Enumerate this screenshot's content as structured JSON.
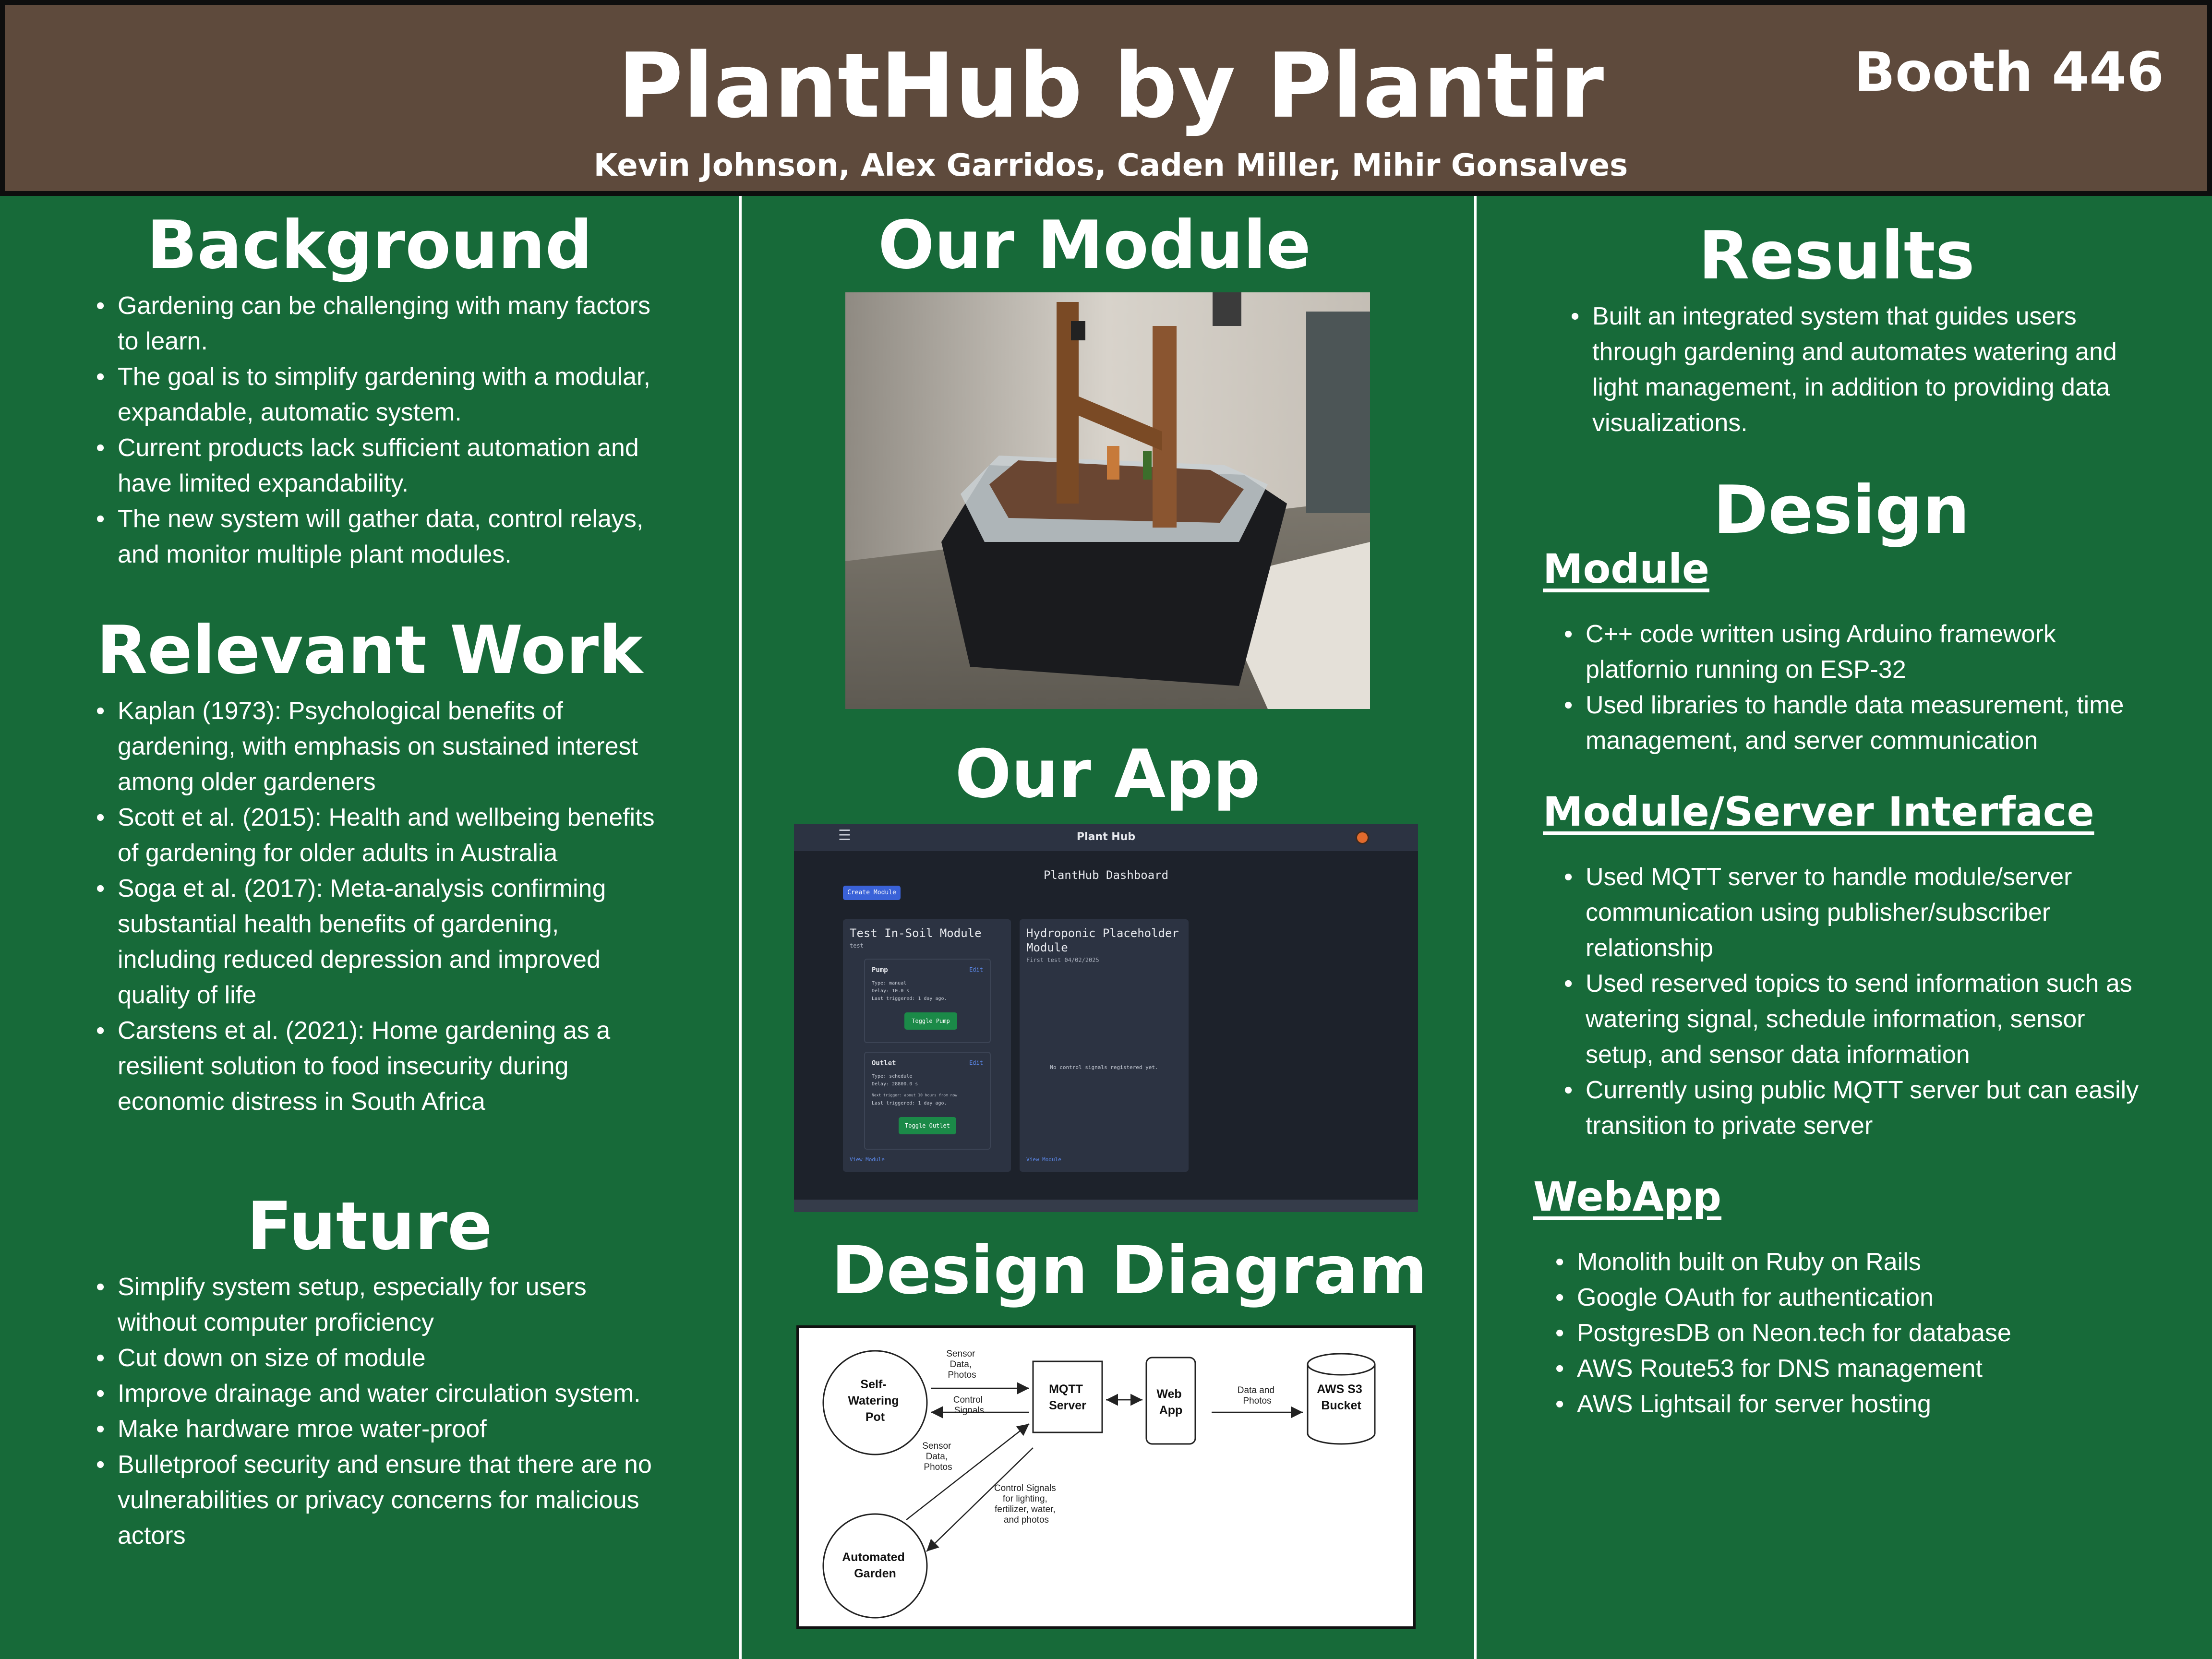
{
  "header": {
    "title": "PlantHub by Plantir",
    "authors": "Kevin Johnson, Alex Garridos, Caden Miller, Mihir Gonsalves",
    "booth": "Booth 446"
  },
  "background": {
    "heading": "Background",
    "bullets": [
      "Gardening can be challenging with many factors to learn.",
      "The goal is to simplify gardening with a modular, expandable, automatic system.",
      "Current products lack sufficient automation and have limited expandability.",
      "The new system will gather data, control relays, and monitor multiple plant modules."
    ]
  },
  "relevant_work": {
    "heading": "Relevant Work",
    "bullets": [
      "Kaplan (1973): Psychological benefits of gardening, with emphasis on sustained interest among older gardeners",
      "Scott et al. (2015): Health and wellbeing benefits of gardening for older adults in Australia",
      "Soga et al. (2017): Meta-analysis confirming substantial health benefits of gardening, including reduced depression and improved quality of life",
      "Carstens et al. (2021): Home gardening as a resilient solution to food insecurity during economic distress in South Africa"
    ]
  },
  "future": {
    "heading": "Future",
    "bullets": [
      "Simplify system setup, especially for users without computer proficiency",
      "Cut down on size of module",
      "Improve drainage and water circulation system.",
      "Make hardware mroe water-proof",
      "Bulletproof security and ensure that there are no vulnerabilities or privacy concerns for malicious actors"
    ]
  },
  "our_module": {
    "heading": "Our Module"
  },
  "our_app": {
    "heading": "Our App",
    "screenshot": {
      "brand": "Plant Hub",
      "dashboard_title": "PlantHub Dashboard",
      "create_button": "Create Module",
      "card1": {
        "title": "Test In-Soil Module",
        "subtitle": "test",
        "pump": {
          "title": "Pump",
          "edit": "Edit",
          "lines": [
            "Type: manual",
            "Delay: 10.0 s",
            "Last triggered: 1 day ago."
          ],
          "toggle": "Toggle Pump"
        },
        "outlet": {
          "title": "Outlet",
          "edit": "Edit",
          "lines": [
            "Type: schedule",
            "Delay: 28800.0 s",
            "Next trigger: about 10 hours from now",
            "Last triggered: 1 day ago."
          ],
          "toggle": "Toggle Outlet"
        },
        "view": "View Module"
      },
      "card2": {
        "title_line1": "Hydroponic Placeholder",
        "title_line2": "Module",
        "subtitle": "First test 04/02/2025",
        "no_signals": "No control signals registered yet.",
        "view": "View Module"
      }
    }
  },
  "design_diagram": {
    "heading": "Design Diagram",
    "nodes": {
      "self_watering_pot": [
        "Self-",
        "Watering",
        "Pot"
      ],
      "automated_garden": [
        "Automated",
        "Garden"
      ],
      "mqtt_server": [
        "MQTT",
        "Server"
      ],
      "web_app": [
        "Web",
        "App"
      ],
      "aws_s3": [
        "AWS S3",
        "Bucket"
      ]
    },
    "labels": {
      "sensor_top": [
        "Sensor",
        "Data,",
        "Photos"
      ],
      "control_top": [
        "Control",
        "Signals"
      ],
      "sensor_mid": [
        "Sensor",
        "Data,",
        "Photos"
      ],
      "control_bottom": [
        "Control Signals",
        "for lighting,",
        "fertilizer, water,",
        "and photos"
      ],
      "data_photos": [
        "Data and",
        "Photos"
      ]
    }
  },
  "results": {
    "heading": "Results",
    "bullets": [
      "Built an integrated system that guides users through gardening and automates watering and light management, in addition to providing data visualizations."
    ]
  },
  "design": {
    "heading": "Design",
    "module": {
      "heading": "Module",
      "bullets": [
        "C++ code written using Arduino framework platfornio running on ESP-32",
        "Used libraries to handle data measurement, time management, and server communication"
      ]
    },
    "interface": {
      "heading": "Module/Server Interface",
      "bullets": [
        "Used MQTT server to handle module/server communication using publisher/subscriber relationship",
        "Used reserved topics to send information such as watering signal, schedule information, sensor setup, and sensor data information",
        "Currently using public MQTT server but can easily transition to private server"
      ]
    },
    "webapp": {
      "heading": "WebApp",
      "bullets": [
        "Monolith built on Ruby on Rails",
        "Google OAuth for authentication",
        "PostgresDB on Neon.tech for database",
        "AWS Route53 for DNS management",
        "AWS Lightsail for server hosting"
      ]
    }
  },
  "colors": {
    "background": "#176a39",
    "header": "#5e4a3c",
    "text": "#ffffff"
  }
}
